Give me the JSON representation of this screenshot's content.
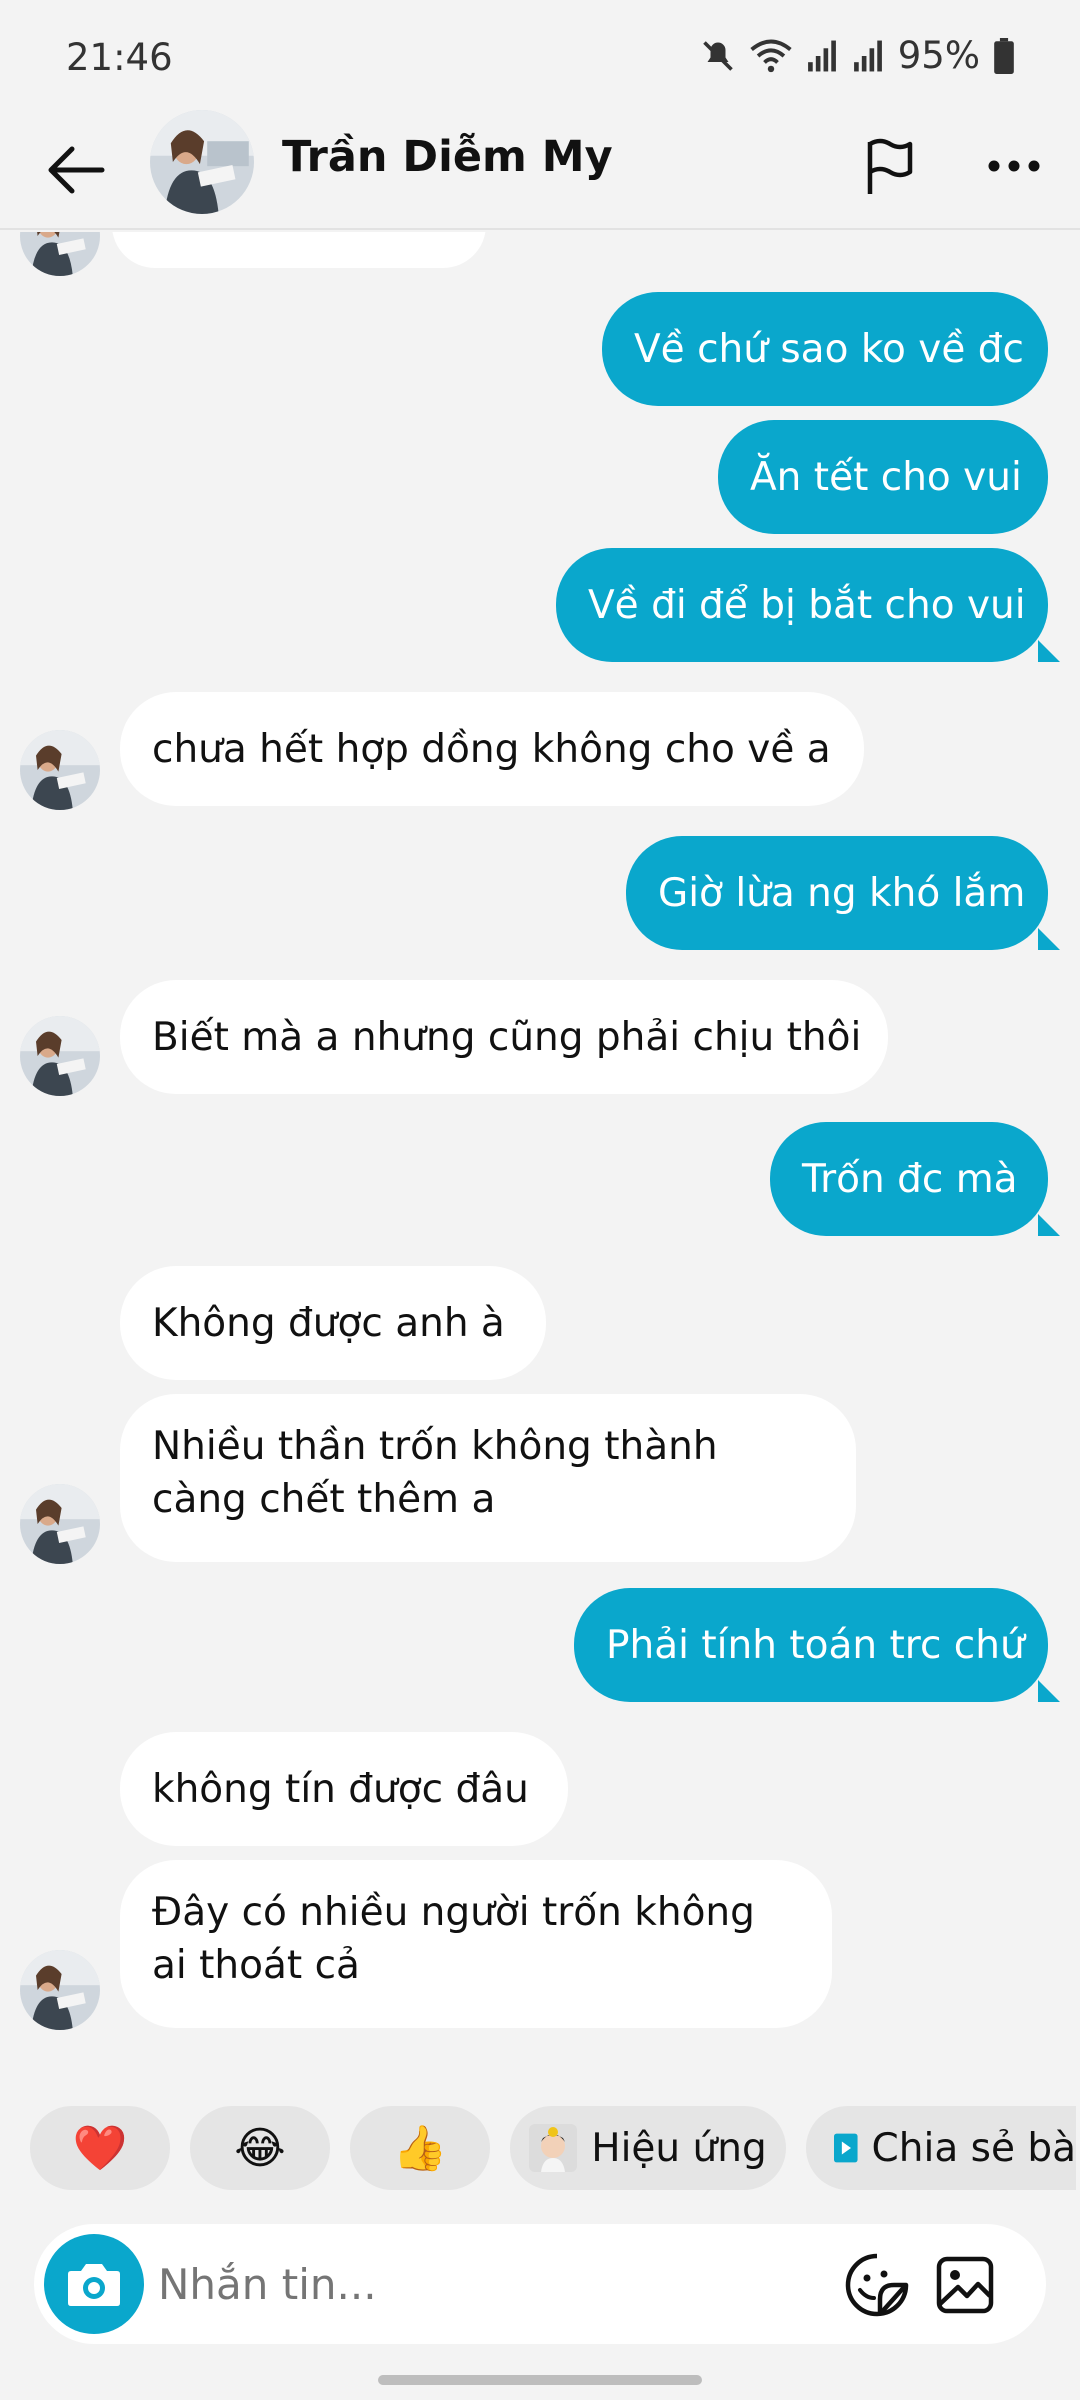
{
  "status_bar": {
    "time": "21:46",
    "battery": "95%",
    "icons": [
      "mute-icon",
      "wifi-icon",
      "signal-icon",
      "signal-icon",
      "battery-icon"
    ]
  },
  "header": {
    "contact_name": "Trần Diễm My",
    "icons": [
      "back-arrow-icon",
      "flag-icon",
      "more-icon"
    ]
  },
  "messages": [
    {
      "dir": "in",
      "text": "",
      "partial": true
    },
    {
      "dir": "out",
      "text": "Về chứ sao ko về đc"
    },
    {
      "dir": "out",
      "text": "Ăn tết cho vui"
    },
    {
      "dir": "out",
      "text": "Về đi để bị bắt cho vui"
    },
    {
      "dir": "in",
      "text": "chưa hết hợp dồng không cho về a"
    },
    {
      "dir": "out",
      "text": "Giờ lừa ng khó lắm"
    },
    {
      "dir": "in",
      "text": "Biết mà a nhưng cũng phải chịu thôi"
    },
    {
      "dir": "out",
      "text": "Trốn đc mà"
    },
    {
      "dir": "in",
      "text": "Không được anh à"
    },
    {
      "dir": "in",
      "text": "Nhiều thần trốn không thành càng chết thêm a"
    },
    {
      "dir": "out",
      "text": "Phải tính toán trc chứ"
    },
    {
      "dir": "in",
      "text": "không tín được đâu"
    },
    {
      "dir": "in",
      "text": "Đây có nhiều người trốn không ai thoát cả"
    }
  ],
  "quick_actions": [
    {
      "name": "heart",
      "emoji": "❤️",
      "label": ""
    },
    {
      "name": "laugh",
      "emoji": "😂",
      "label": ""
    },
    {
      "name": "thumbs-up",
      "emoji": "👍",
      "label": ""
    },
    {
      "name": "effects",
      "emoji": "",
      "label": "Hiệu ứng"
    },
    {
      "name": "share",
      "emoji": "",
      "label": "Chia sẻ bà"
    }
  ],
  "composer": {
    "placeholder": "Nhắn tin..."
  },
  "colors": {
    "outgoing_bubble": "#0aa7cc",
    "incoming_bubble": "#ffffff",
    "background": "#f3f3f3"
  }
}
